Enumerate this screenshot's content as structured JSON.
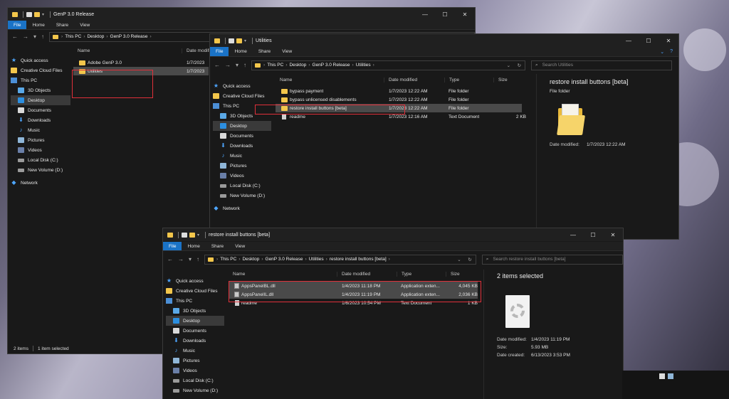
{
  "window1": {
    "title": "GenP 3.0 Release",
    "tabs": {
      "file": "File",
      "home": "Home",
      "share": "Share",
      "view": "View"
    },
    "breadcrumb": [
      "This PC",
      "Desktop",
      "GenP 3.0 Release"
    ],
    "nav": {
      "quick_access": "Quick access",
      "creative_cloud": "Creative Cloud Files",
      "this_pc": "This PC",
      "objects": "3D Objects",
      "desktop": "Desktop",
      "documents": "Documents",
      "downloads": "Downloads",
      "music": "Music",
      "pictures": "Pictures",
      "videos": "Videos",
      "local_disk": "Local Disk (C:)",
      "new_volume": "New Volume (D:)",
      "network": "Network"
    },
    "columns": {
      "name": "Name",
      "date": "Date modified"
    },
    "rows": [
      {
        "name": "Adobe GenP 3.0",
        "date": "1/7/2023"
      },
      {
        "name": "Utilities",
        "date": "1/7/2023"
      }
    ],
    "status": {
      "items": "2 items",
      "selected": "1 item selected"
    }
  },
  "window2": {
    "title": "Utilities",
    "tabs": {
      "file": "File",
      "home": "Home",
      "share": "Share",
      "view": "View"
    },
    "breadcrumb": [
      "This PC",
      "Desktop",
      "GenP 3.0 Release",
      "Utilities"
    ],
    "search_placeholder": "Search Utilities",
    "nav": {
      "quick_access": "Quick access",
      "creative_cloud": "Creative Cloud Files",
      "this_pc": "This PC",
      "objects": "3D Objects",
      "desktop": "Desktop",
      "documents": "Documents",
      "downloads": "Downloads",
      "music": "Music",
      "pictures": "Pictures",
      "videos": "Videos",
      "local_disk": "Local Disk (C:)",
      "new_volume": "New Volume (D:)",
      "network": "Network"
    },
    "columns": {
      "name": "Name",
      "date": "Date modified",
      "type": "Type",
      "size": "Size"
    },
    "rows": [
      {
        "name": "bypass payment",
        "date": "1/7/2023 12:22 AM",
        "type": "File folder",
        "size": ""
      },
      {
        "name": "bypass unlicensed disablements",
        "date": "1/7/2023 12:22 AM",
        "type": "File folder",
        "size": ""
      },
      {
        "name": "restore install buttons [beta]",
        "date": "1/7/2023 12:22 AM",
        "type": "File folder",
        "size": ""
      },
      {
        "name": "readme",
        "date": "1/7/2023 12:16 AM",
        "type": "Text Document",
        "size": "2 KB"
      }
    ],
    "preview": {
      "title": "restore install buttons [beta]",
      "subtitle": "File folder",
      "date_key": "Date modified:",
      "date_val": "1/7/2023 12:22 AM"
    }
  },
  "window3": {
    "title": "restore install buttons [beta]",
    "tabs": {
      "file": "File",
      "home": "Home",
      "share": "Share",
      "view": "View"
    },
    "breadcrumb": [
      "This PC",
      "Desktop",
      "GenP 3.0 Release",
      "Utilities",
      "restore install buttons [beta]"
    ],
    "search_placeholder": "Search restore install buttons [beta]",
    "nav": {
      "quick_access": "Quick access",
      "creative_cloud": "Creative Cloud Files",
      "this_pc": "This PC",
      "objects": "3D Objects",
      "desktop": "Desktop",
      "documents": "Documents",
      "downloads": "Downloads",
      "music": "Music",
      "pictures": "Pictures",
      "videos": "Videos",
      "local_disk": "Local Disk (C:)",
      "new_volume": "New Volume (D:)"
    },
    "columns": {
      "name": "Name",
      "date": "Date modified",
      "type": "Type",
      "size": "Size"
    },
    "rows": [
      {
        "name": "AppsPanelBL.dll",
        "date": "1/4/2023 11:18 PM",
        "type": "Application exten...",
        "size": "4,045 KB"
      },
      {
        "name": "AppsPanelIL.dll",
        "date": "1/4/2023 11:19 PM",
        "type": "Application exten...",
        "size": "2,036 KB"
      },
      {
        "name": "readme",
        "date": "1/6/2023 10:54 PM",
        "type": "Text Document",
        "size": "1 KB"
      }
    ],
    "preview": {
      "title": "2 items selected",
      "meta": [
        {
          "k": "Date modified:",
          "v": "1/4/2023 11:19 PM"
        },
        {
          "k": "Size:",
          "v": "5.93 MB"
        },
        {
          "k": "Date created:",
          "v": "6/13/2023 3:53 PM"
        }
      ]
    }
  }
}
